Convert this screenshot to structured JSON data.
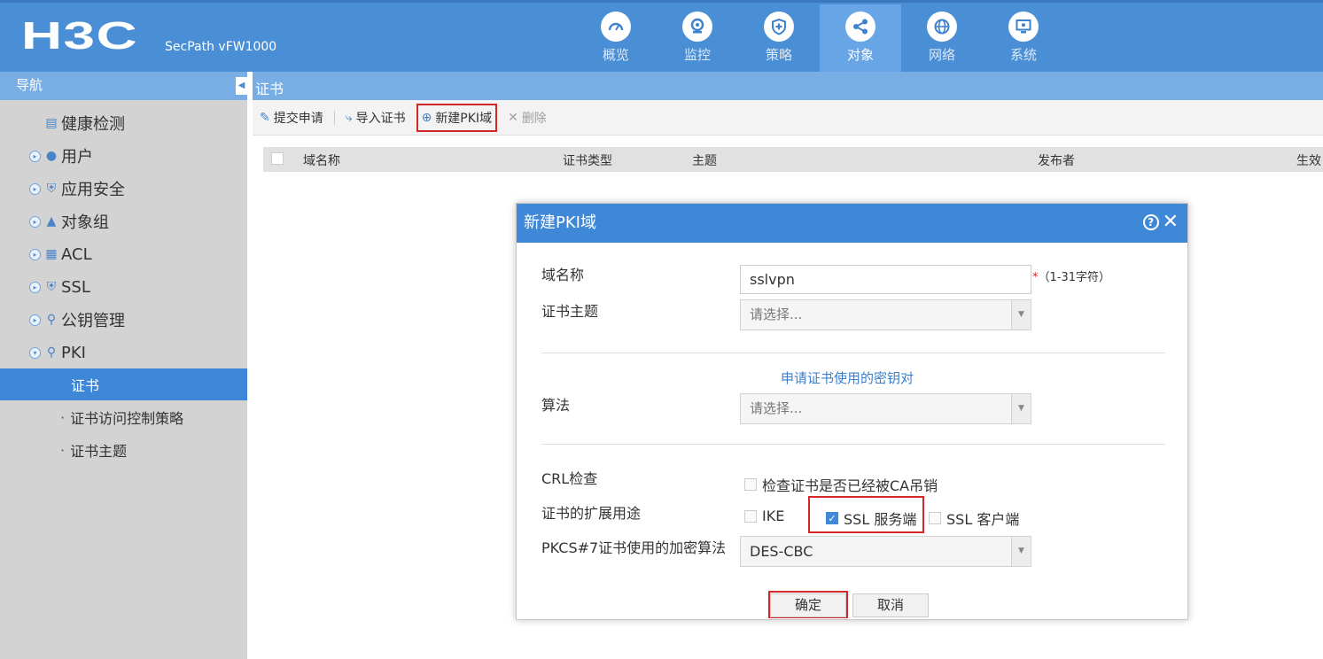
{
  "header": {
    "logo": "H3C",
    "product": "SecPath vFW1000",
    "nav": [
      {
        "label": "概览",
        "icon": "gauge-icon"
      },
      {
        "label": "监控",
        "icon": "monitor-icon"
      },
      {
        "label": "策略",
        "icon": "shield-plus-icon"
      },
      {
        "label": "对象",
        "icon": "share-icon",
        "active": true
      },
      {
        "label": "网络",
        "icon": "globe-icon"
      },
      {
        "label": "系统",
        "icon": "desktop-icon"
      }
    ]
  },
  "sidebar": {
    "title": "导航",
    "items": [
      {
        "label": "健康检测",
        "icon": "health-check-icon"
      },
      {
        "label": "用户",
        "icon": "user-icon"
      },
      {
        "label": "应用安全",
        "icon": "app-security-icon"
      },
      {
        "label": "对象组",
        "icon": "object-group-icon"
      },
      {
        "label": "ACL",
        "icon": "acl-icon"
      },
      {
        "label": "SSL",
        "icon": "ssl-shield-icon"
      },
      {
        "label": "公钥管理",
        "icon": "key-icon"
      },
      {
        "label": "PKI",
        "icon": "pki-key-icon"
      }
    ],
    "sub_items": [
      {
        "label": "证书",
        "selected": true
      },
      {
        "label": "证书访问控制策略"
      },
      {
        "label": "证书主题"
      }
    ]
  },
  "main": {
    "breadcrumb": "证书",
    "toolbar": {
      "submit": "提交申请",
      "import": "导入证书",
      "new_pki": "新建PKI域",
      "delete": "删除"
    },
    "table_headers": [
      "域名称",
      "证书类型",
      "主题",
      "发布者",
      "生效"
    ]
  },
  "dialog": {
    "title": "新建PKI域",
    "domain_label": "域名称",
    "domain_value": "sslvpn",
    "domain_hint": "（1-31字符）",
    "subject_label": "证书主题",
    "subject_placeholder": "请选择...",
    "keypair_section": "申请证书使用的密钥对",
    "algo_label": "算法",
    "algo_placeholder": "请选择...",
    "crl_label": "CRL检查",
    "crl_option": "检查证书是否已经被CA吊销",
    "ext_label": "证书的扩展用途",
    "ext_ike": "IKE",
    "ext_ssl_server": "SSL 服务端",
    "ext_ssl_client": "SSL 客户端",
    "pkcs_label": "PKCS#7证书使用的加密算法",
    "pkcs_value": "DES-CBC",
    "ok": "确定",
    "cancel": "取消"
  }
}
